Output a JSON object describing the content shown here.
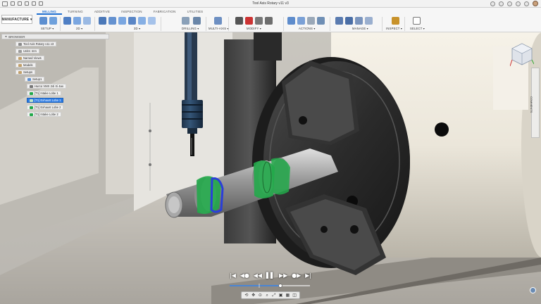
{
  "window": {
    "title": "Tool Axis Rotary v11 v3"
  },
  "workspace": {
    "label": "MANUFACTURE"
  },
  "tabs": [
    "MILLING",
    "TURNING",
    "ADDITIVE",
    "INSPECTION",
    "FABRICATION",
    "UTILITIES"
  ],
  "ribbon_groups": [
    "SETUP",
    "2D",
    "3D",
    "DRILLING",
    "MULTI-AXIS",
    "MODIFY",
    "ACTIONS",
    "MANAGE",
    "INSPECT",
    "SELECT"
  ],
  "browser": {
    "header": "BROWSER",
    "nodes": [
      "Tool Axis Rotary v11 v3",
      "Units: mm",
      "Named Views",
      "Models",
      "Setups",
      "Setup1",
      "Hurco VMX 24i Xi 4ax",
      "[T1] Intake Lobe 1",
      "[T1] Exhaust Lobe 1",
      "[T1] Exhaust Lobe 2",
      "[T1] Intake Lobe 2"
    ]
  },
  "comments_label": "COMMENTS",
  "playback": {
    "buttons": [
      "|◀",
      "◀●",
      "◀◀",
      "▌▌",
      "▶▶",
      "●▶",
      "▶|"
    ]
  },
  "colors": {
    "accent": "#1f6fd1",
    "selected_row": "#2c7be5",
    "toolpath_green": "#22a94a",
    "toolpath_blue": "#2a3fd8"
  },
  "icons": {
    "navbar": [
      "orbit-icon",
      "pan-icon",
      "look-at-icon",
      "zoom-icon",
      "fit-icon",
      "display-settings-icon",
      "grid-icon",
      "viewports-icon"
    ]
  }
}
